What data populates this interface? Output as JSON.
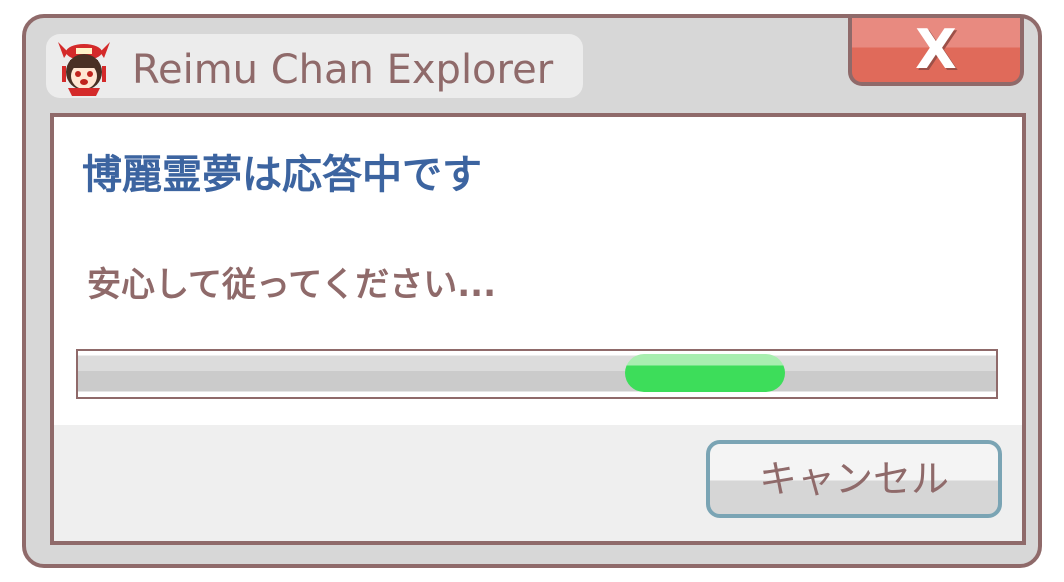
{
  "window": {
    "title": "Reimu Chan Explorer",
    "close_label": "X",
    "icon": "reimu-avatar-icon"
  },
  "dialog": {
    "heading": "博麗霊夢は応答中です",
    "message": "安心して従ってください...",
    "progress": {
      "fraction": 0.6,
      "style": "indeterminate"
    },
    "cancel_label": "キャンセル"
  },
  "colors": {
    "border": "#8f6a6a",
    "heading": "#3c64a0",
    "close": "#e06a5a",
    "progress": "#3ddd5a",
    "cancel_border": "#7aa4b4"
  }
}
